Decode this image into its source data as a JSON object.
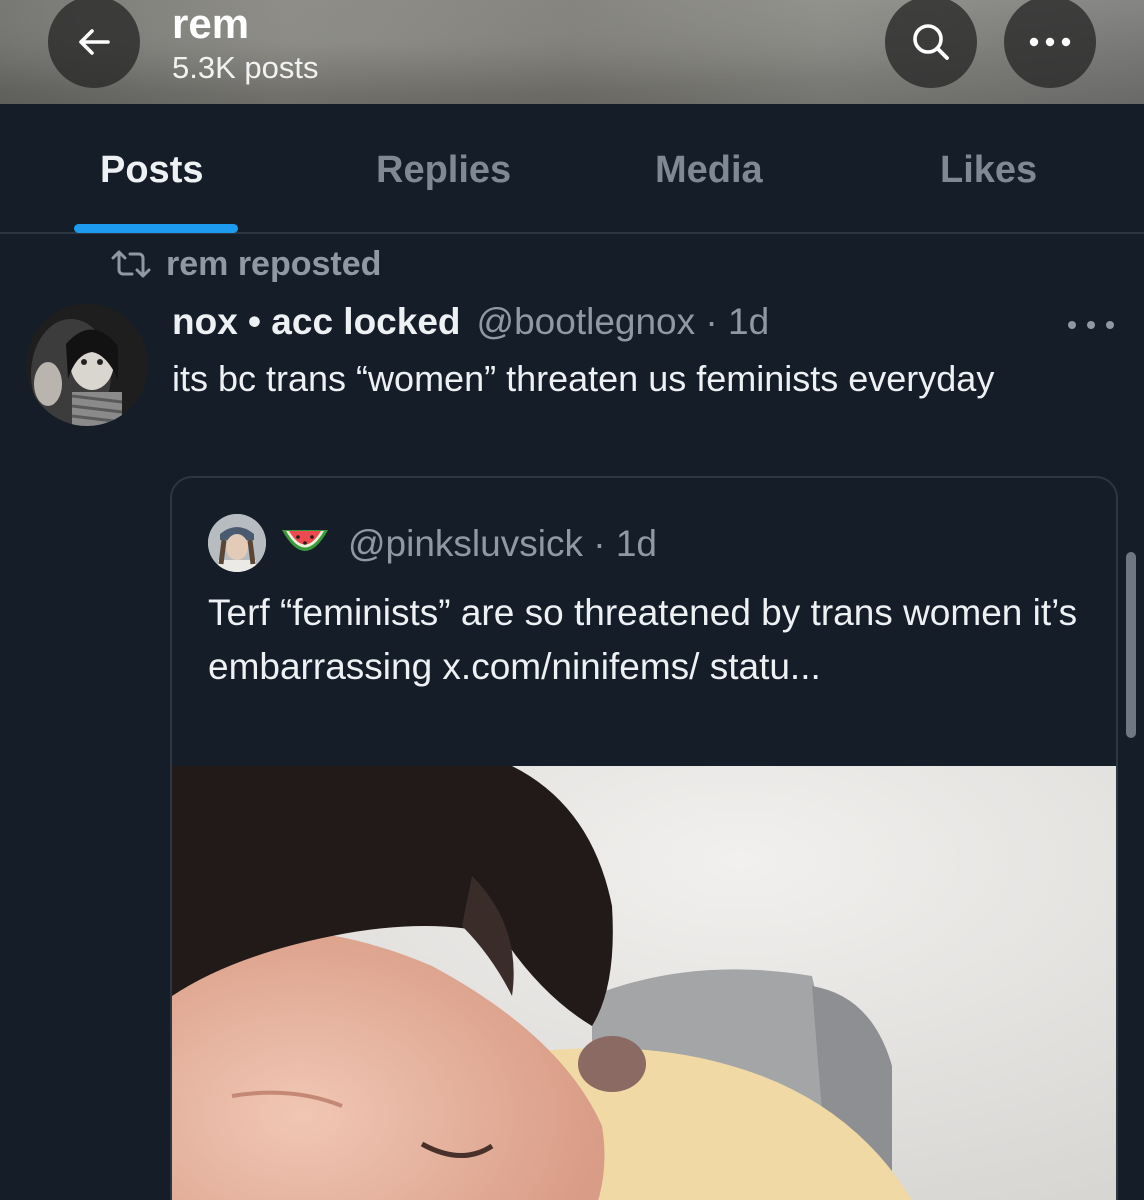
{
  "header": {
    "name": "rem",
    "post_count": "5.3K posts",
    "back_icon": "arrow-left-icon",
    "search_icon": "search-icon",
    "more_icon": "more-horizontal-icon"
  },
  "tabs": [
    {
      "label": "Posts",
      "active": true
    },
    {
      "label": "Replies",
      "active": false
    },
    {
      "label": "Media",
      "active": false
    },
    {
      "label": "Likes",
      "active": false
    }
  ],
  "repost": {
    "icon": "repost-icon",
    "text": "rem reposted"
  },
  "tweet": {
    "display_name": "nox • acc locked",
    "meta": "@bootlegnox · 1d",
    "text": "its bc trans “women” threaten us feminists everyday",
    "more_icon": "more-horizontal-icon"
  },
  "quote": {
    "emoji": "watermelon",
    "meta": "@pinksluvsick · 1d",
    "text": "Terf “feminists” are so threatened by trans women it’s embarrassing x.com/ninifems/ statu..."
  },
  "colors": {
    "background": "#151d28",
    "accent": "#1d9bf0",
    "secondary_text": "#8f98a3"
  }
}
